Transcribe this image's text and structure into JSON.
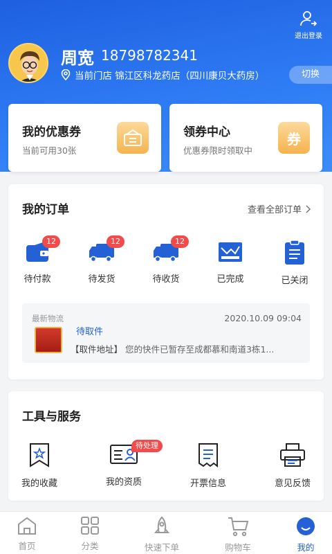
{
  "header": {
    "logout_label": "退出登录",
    "user_name": "周宽",
    "user_phone": "18798782341",
    "store_text": "当前门店 锦江区科龙药店（四川康贝大药房）",
    "switch_label": "切换"
  },
  "coupons": {
    "mine_title": "我的优惠券",
    "mine_sub": "当前可用30张",
    "center_title": "领券中心",
    "center_sub": "优惠券限时领取中",
    "center_icon_text": "券"
  },
  "orders": {
    "title": "我的订单",
    "view_all": "查看全部订单",
    "items": [
      {
        "label": "待付款",
        "badge": "12"
      },
      {
        "label": "待发货",
        "badge": "12"
      },
      {
        "label": "待收货",
        "badge": "12"
      },
      {
        "label": "已完成"
      },
      {
        "label": "已关闭"
      }
    ],
    "logistics": {
      "label": "最新物流",
      "time": "2020.10.09   09:04",
      "status": "待取件",
      "tag": "【取件地址】",
      "detail": "您的快件已暂存至成都慕和南道3栋1..."
    }
  },
  "tools": {
    "title": "工具与服务",
    "items": [
      {
        "label": "我的收藏"
      },
      {
        "label": "我的资质",
        "badge": "待处理"
      },
      {
        "label": "开票信息"
      },
      {
        "label": "意见反馈"
      }
    ]
  },
  "tabbar": {
    "items": [
      {
        "label": "首页"
      },
      {
        "label": "分类"
      },
      {
        "label": "快速下单"
      },
      {
        "label": "购物车"
      },
      {
        "label": "我的"
      }
    ]
  },
  "colors": {
    "brand_blue": "#2461d4",
    "badge_red": "#f24b4b",
    "coupon_gold": "#f5b34e"
  }
}
